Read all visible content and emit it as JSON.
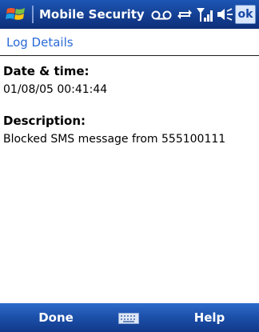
{
  "titlebar": {
    "app_title": "Mobile Security",
    "ok_label": "ok",
    "icons": [
      "windows-start-icon",
      "voicemail-icon",
      "sync-icon",
      "signal-icon",
      "speaker-icon"
    ]
  },
  "header": {
    "title": "Log Details"
  },
  "details": {
    "datetime_label": "Date & time:",
    "datetime_value": "01/08/05 00:41:44",
    "description_label": "Description:",
    "description_value": "Blocked SMS message from 555100111"
  },
  "menubar": {
    "left_label": "Done",
    "right_label": "Help",
    "center_icon": "keyboard-icon"
  },
  "colors": {
    "titlebar_bg": "#143f92",
    "header_text": "#2a6ad6",
    "menubar_bg": "#1b4fa8"
  }
}
